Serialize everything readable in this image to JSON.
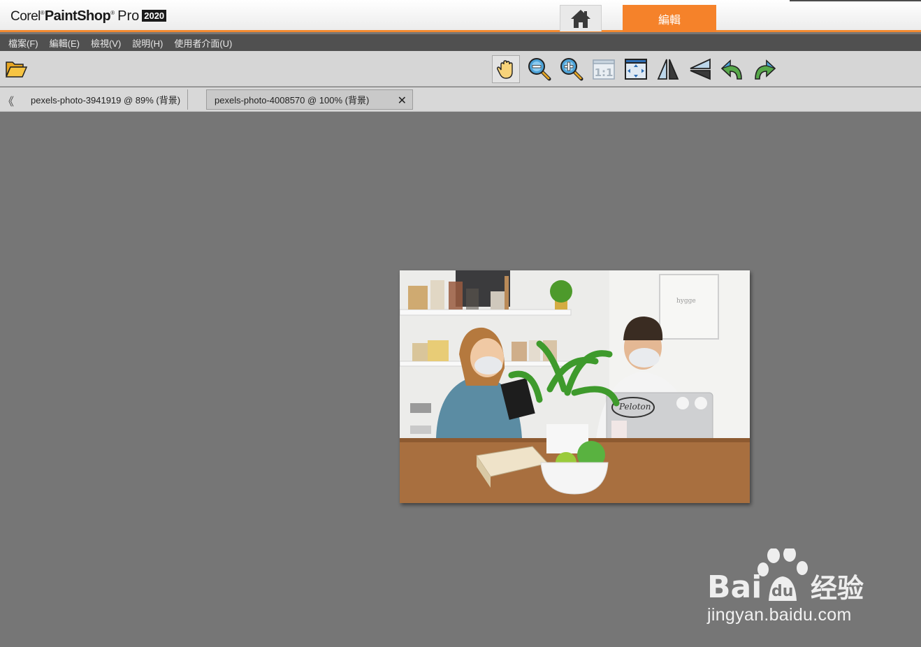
{
  "app": {
    "logo_corel": "Corel",
    "logo_paintshop": "PaintShop",
    "logo_pro": "Pro",
    "logo_year": "2020",
    "edit_tab_label": "編輯",
    "accent_color": "#f5822a"
  },
  "menu": {
    "items": [
      "檔案(F)",
      "編輯(E)",
      "檢視(V)",
      "說明(H)",
      "使用者介面(U)"
    ]
  },
  "toolbar": {
    "tools": [
      "open-folder-icon",
      "pan-hand-icon",
      "zoom-out-icon",
      "zoom-in-icon",
      "actual-size-icon",
      "fit-window-icon",
      "flip-horizontal-icon",
      "mirror-icon",
      "rotate-left-icon",
      "rotate-right-icon"
    ],
    "actual_size_label": "1:1"
  },
  "tabs": [
    {
      "label": "pexels-photo-3941919 @  89% (背景)",
      "active": false
    },
    {
      "label": "pexels-photo-4008570 @ 100% (背景)",
      "active": true,
      "close": "✕"
    }
  ],
  "tab_scroll_glyph": "《",
  "watermark": {
    "brand": "Bai",
    "suffix": "经验",
    "url": "jingyan.baidu.com"
  }
}
